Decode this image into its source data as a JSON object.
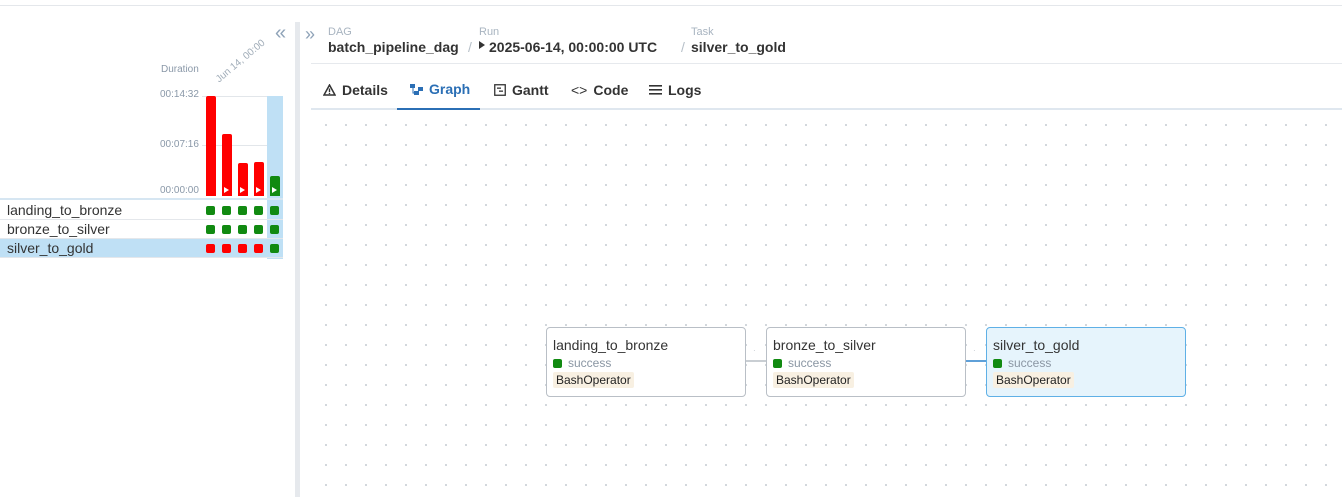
{
  "left_panel": {
    "collapse_icon": "double-chevron-left-icon",
    "duration_label": "Duration",
    "date_label": "Jun 14, 00:00",
    "y_ticks": [
      "00:14:32",
      "00:07:16",
      "00:00:00"
    ],
    "run_bars": [
      {
        "duration": "00:14:32",
        "fraction": 1.0,
        "status": "failed",
        "color": "#ff0000",
        "play_icon": false
      },
      {
        "duration": "00:08:56",
        "fraction": 0.62,
        "status": "failed",
        "color": "#ff0000",
        "play_icon": true
      },
      {
        "duration": "00:04:42",
        "fraction": 0.33,
        "status": "failed",
        "color": "#ff0000",
        "play_icon": true
      },
      {
        "duration": "00:04:57",
        "fraction": 0.34,
        "status": "failed",
        "color": "#ff0000",
        "play_icon": true
      },
      {
        "duration": "00:02:54",
        "fraction": 0.2,
        "status": "success",
        "color": "#118a11",
        "play_icon": true
      }
    ],
    "tasks": [
      {
        "name": "landing_to_bronze",
        "statuses": [
          "success",
          "success",
          "success",
          "success",
          "success"
        ],
        "selected": false
      },
      {
        "name": "bronze_to_silver",
        "statuses": [
          "success",
          "success",
          "success",
          "success",
          "success"
        ],
        "selected": false
      },
      {
        "name": "silver_to_gold",
        "statuses": [
          "failed",
          "failed",
          "failed",
          "failed",
          "success"
        ],
        "selected": true
      }
    ]
  },
  "colors": {
    "success": "#118a11",
    "failed": "#ff0000",
    "accent": "#2b6fb5",
    "selection": "#bfe0f5"
  },
  "breadcrumb": {
    "expand_icon": "double-chevron-right-icon",
    "dag_kicker": "DAG",
    "dag_value": "batch_pipeline_dag",
    "run_kicker": "Run",
    "run_value": "2025-06-14, 00:00:00 UTC",
    "task_kicker": "Task",
    "task_value": "silver_to_gold",
    "separator": "/"
  },
  "tabs": [
    {
      "label": "Details",
      "icon": "warning-triangle-icon",
      "active": false
    },
    {
      "label": "Graph",
      "icon": "graph-icon",
      "active": true
    },
    {
      "label": "Gantt",
      "icon": "gantt-icon",
      "active": false
    },
    {
      "label": "Code",
      "icon": "code-icon",
      "active": false
    },
    {
      "label": "Logs",
      "icon": "list-icon",
      "active": false
    }
  ],
  "graph": {
    "nodes": [
      {
        "name": "landing_to_bronze",
        "status": "success",
        "operator": "BashOperator",
        "selected": false
      },
      {
        "name": "bronze_to_silver",
        "status": "success",
        "operator": "BashOperator",
        "selected": false
      },
      {
        "name": "silver_to_gold",
        "status": "success",
        "operator": "BashOperator",
        "selected": true
      }
    ]
  }
}
